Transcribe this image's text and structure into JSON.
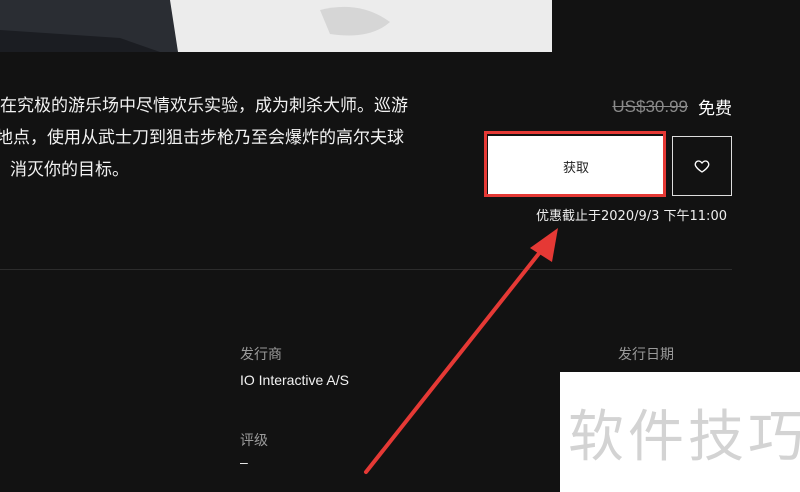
{
  "description": {
    "line1": "在究极的游乐场中尽情欢乐实验，成为刺杀大师。巡游",
    "line2": "地点，使用从武士刀到狙击步枪乃至会爆炸的高尔夫球",
    "line3": "消灭你的目标。"
  },
  "price": {
    "original": "US$30.99",
    "current": "免费"
  },
  "actions": {
    "get_label": "获取",
    "wishlist_icon": "heart-icon"
  },
  "offer": {
    "deadline": "优惠截止于2020/9/3 下午11:00"
  },
  "details": {
    "publisher_label": "发行商",
    "publisher_value": "IO Interactive A/S",
    "rating_label": "评级",
    "rating_value": "–",
    "release_label": "发行日期"
  },
  "watermark": {
    "text": "软件技巧"
  },
  "colors": {
    "annotation_red": "#e53935",
    "background": "#121212"
  }
}
